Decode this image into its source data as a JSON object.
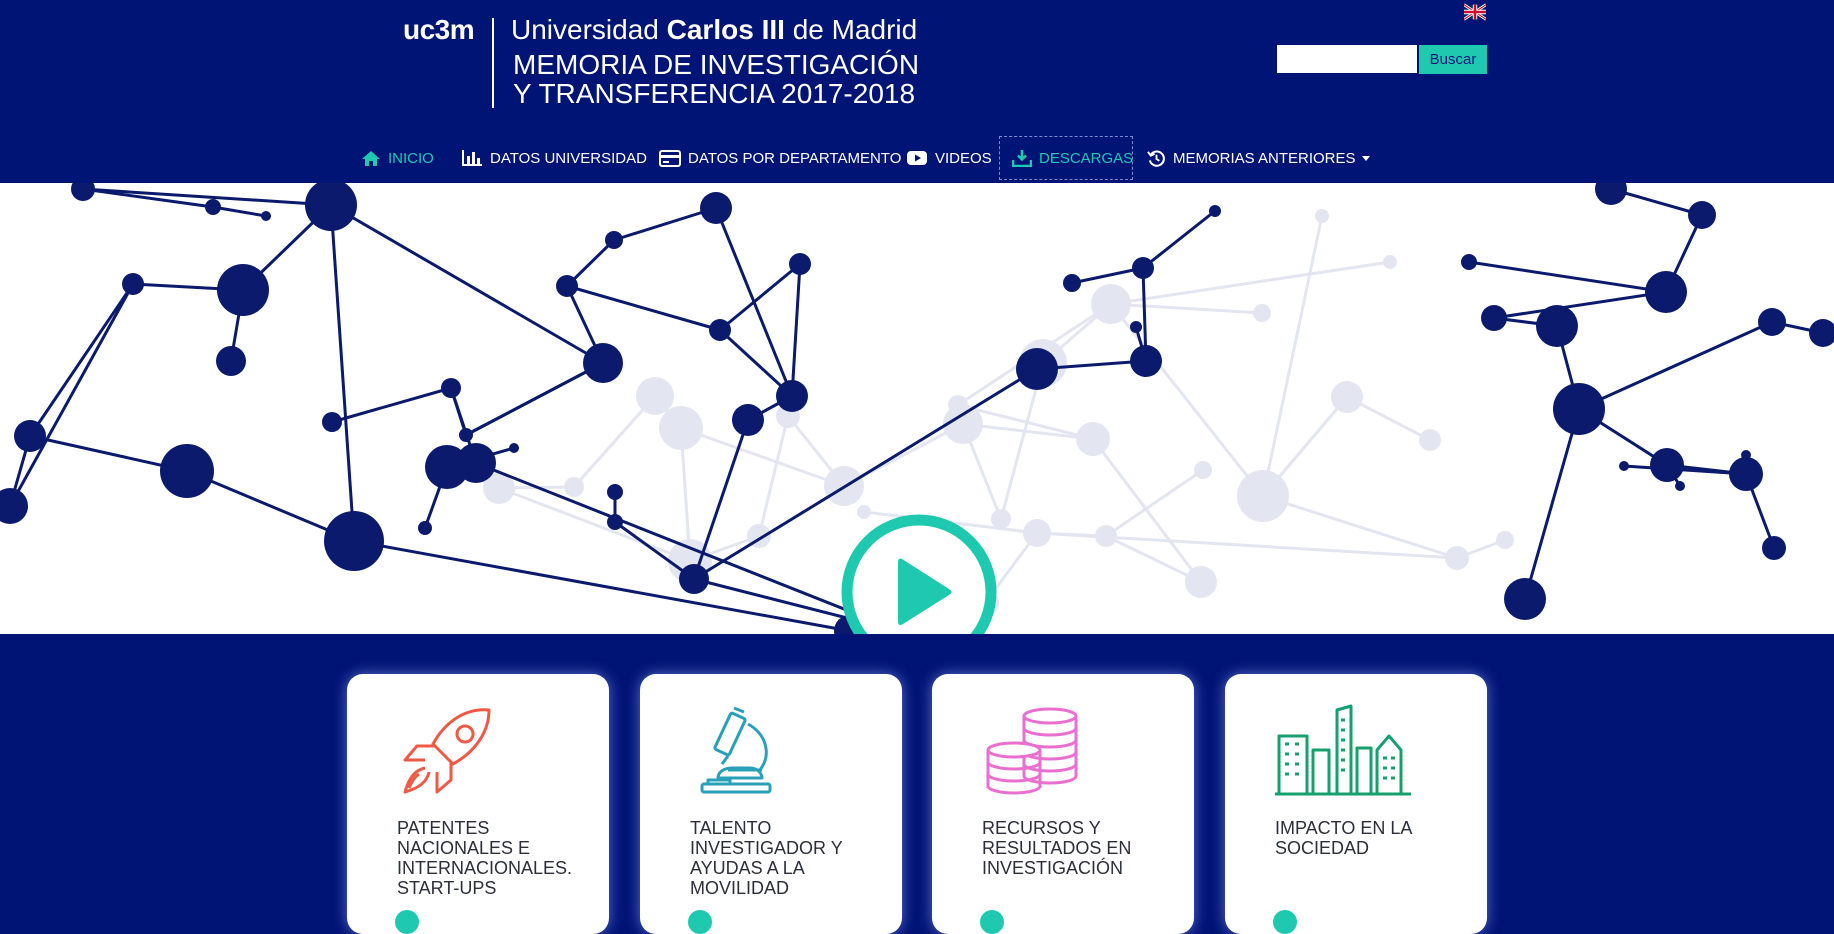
{
  "header": {
    "logo_text": "uc3m",
    "university_prefix": "Universidad",
    "university_bold": "Carlos III",
    "university_suffix": "de Madrid",
    "memoria_line1": "MEMORIA DE INVESTIGACIÓN",
    "memoria_line2": "Y TRANSFERENCIA 2017-2018",
    "language_flag": "uk-flag-icon"
  },
  "search": {
    "value": "",
    "placeholder": "",
    "button_label": "Buscar"
  },
  "nav": {
    "items": [
      {
        "label": "INICIO",
        "icon": "home-icon",
        "active": true
      },
      {
        "label": "DATOS UNIVERSIDAD",
        "icon": "bar-chart-icon"
      },
      {
        "label": "DATOS POR DEPARTAMENTO",
        "icon": "card-icon"
      },
      {
        "label": "VIDEOS",
        "icon": "youtube-icon"
      },
      {
        "label": "DESCARGAS",
        "icon": "download-icon",
        "focused": true
      },
      {
        "label": "MEMORIAS ANTERIORES",
        "icon": "history-icon",
        "dropdown": true
      }
    ]
  },
  "hero": {
    "play_icon": "play-icon"
  },
  "cards": [
    {
      "title": "PATENTES NACIONALES E INTERNACIONALES. START-UPS",
      "icon": "rocket-icon",
      "color": "#ef5a46"
    },
    {
      "title": "TALENTO INVESTIGADOR Y AYUDAS A LA MOVILIDAD",
      "icon": "microscope-icon",
      "color": "#2aa0b8"
    },
    {
      "title": "RECURSOS Y RESULTADOS EN INVESTIGACIÓN",
      "icon": "coins-icon",
      "color": "#ea6fd0"
    },
    {
      "title": "IMPACTO EN LA SOCIEDAD",
      "icon": "buildings-icon",
      "color": "#16a06d"
    }
  ],
  "colors": {
    "navy": "#001475",
    "accent": "#1ec9b0",
    "node_dark": "#0c1a6e",
    "node_light": "#e3e6f0"
  }
}
